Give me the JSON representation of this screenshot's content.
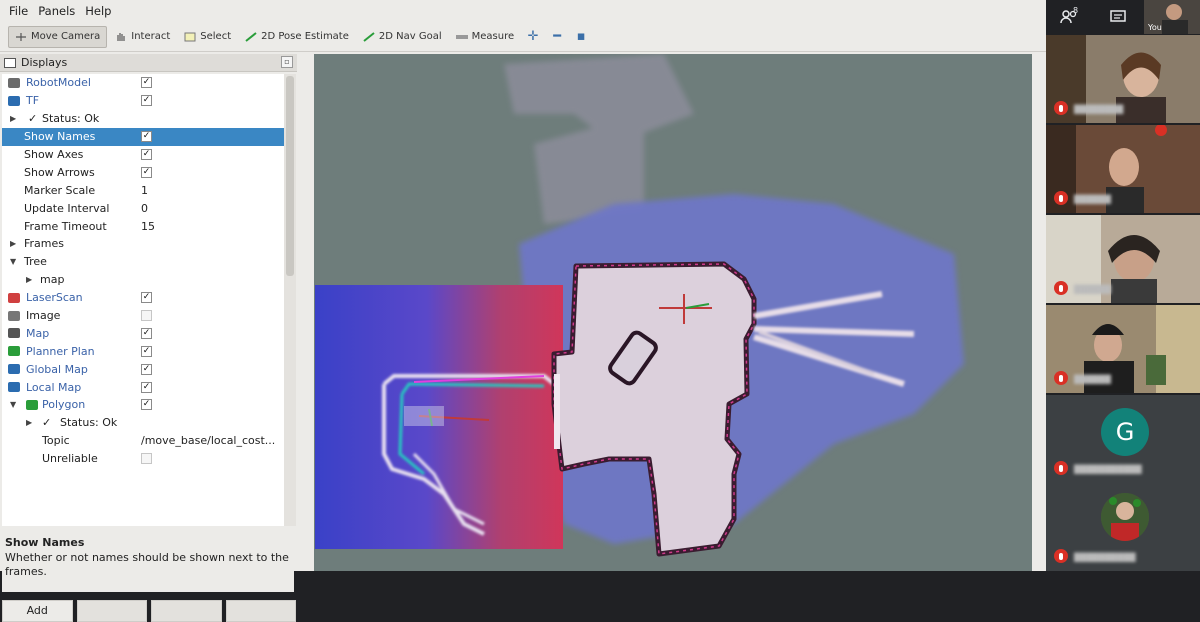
{
  "menubar": {
    "file": "File",
    "panels": "Panels",
    "help": "Help"
  },
  "toolbar": {
    "move_camera": "Move Camera",
    "interact": "Interact",
    "select": "Select",
    "pose_estimate": "2D Pose Estimate",
    "nav_goal": "2D Nav Goal",
    "measure": "Measure",
    "icons": [
      "crosshair-icon",
      "minus-icon",
      "camera-icon"
    ]
  },
  "displays": {
    "title": "Displays",
    "rows": [
      {
        "label": "RobotModel",
        "check": "✓",
        "plugin": true
      },
      {
        "label": "TF",
        "check": "✓",
        "plugin": true
      },
      {
        "label": "Status: Ok",
        "tick": "✓"
      },
      {
        "label": "Show Names",
        "check": "✓"
      },
      {
        "label": "Show Axes",
        "check": "✓"
      },
      {
        "label": "Show Arrows",
        "check": "✓"
      },
      {
        "label": "Marker Scale",
        "value": "1"
      },
      {
        "label": "Update Interval",
        "value": "0"
      },
      {
        "label": "Frame Timeout",
        "value": "15"
      },
      {
        "label": "Frames"
      },
      {
        "label": "Tree"
      },
      {
        "label": "map"
      },
      {
        "label": "LaserScan",
        "check": "✓",
        "plugin": true
      },
      {
        "label": "Image",
        "check": ""
      },
      {
        "label": "Map",
        "check": "✓",
        "plugin": true
      },
      {
        "label": "Planner Plan",
        "check": "✓",
        "plugin": true
      },
      {
        "label": "Global Map",
        "check": "✓",
        "plugin": true
      },
      {
        "label": "Local Map",
        "check": "✓",
        "plugin": true
      },
      {
        "label": "Polygon",
        "check": "✓",
        "plugin": true
      },
      {
        "label": "Status: Ok",
        "tick": "✓"
      },
      {
        "label": "Topic",
        "value": "/move_base/local_cost..."
      },
      {
        "label": "Unreliable",
        "check": ""
      }
    ],
    "help_title": "Show Names",
    "help_text": "Whether or not names should be shown next to the frames.",
    "add_button": "Add"
  },
  "meet": {
    "participant_count": "8",
    "you_label": "You",
    "avatar_letter": "G"
  },
  "colors": {
    "selection": "#3a87c4",
    "map_background": "#6d7c7a",
    "meet_background": "#202124",
    "mic_muted": "#d93025",
    "avatar_g": "#128279"
  }
}
